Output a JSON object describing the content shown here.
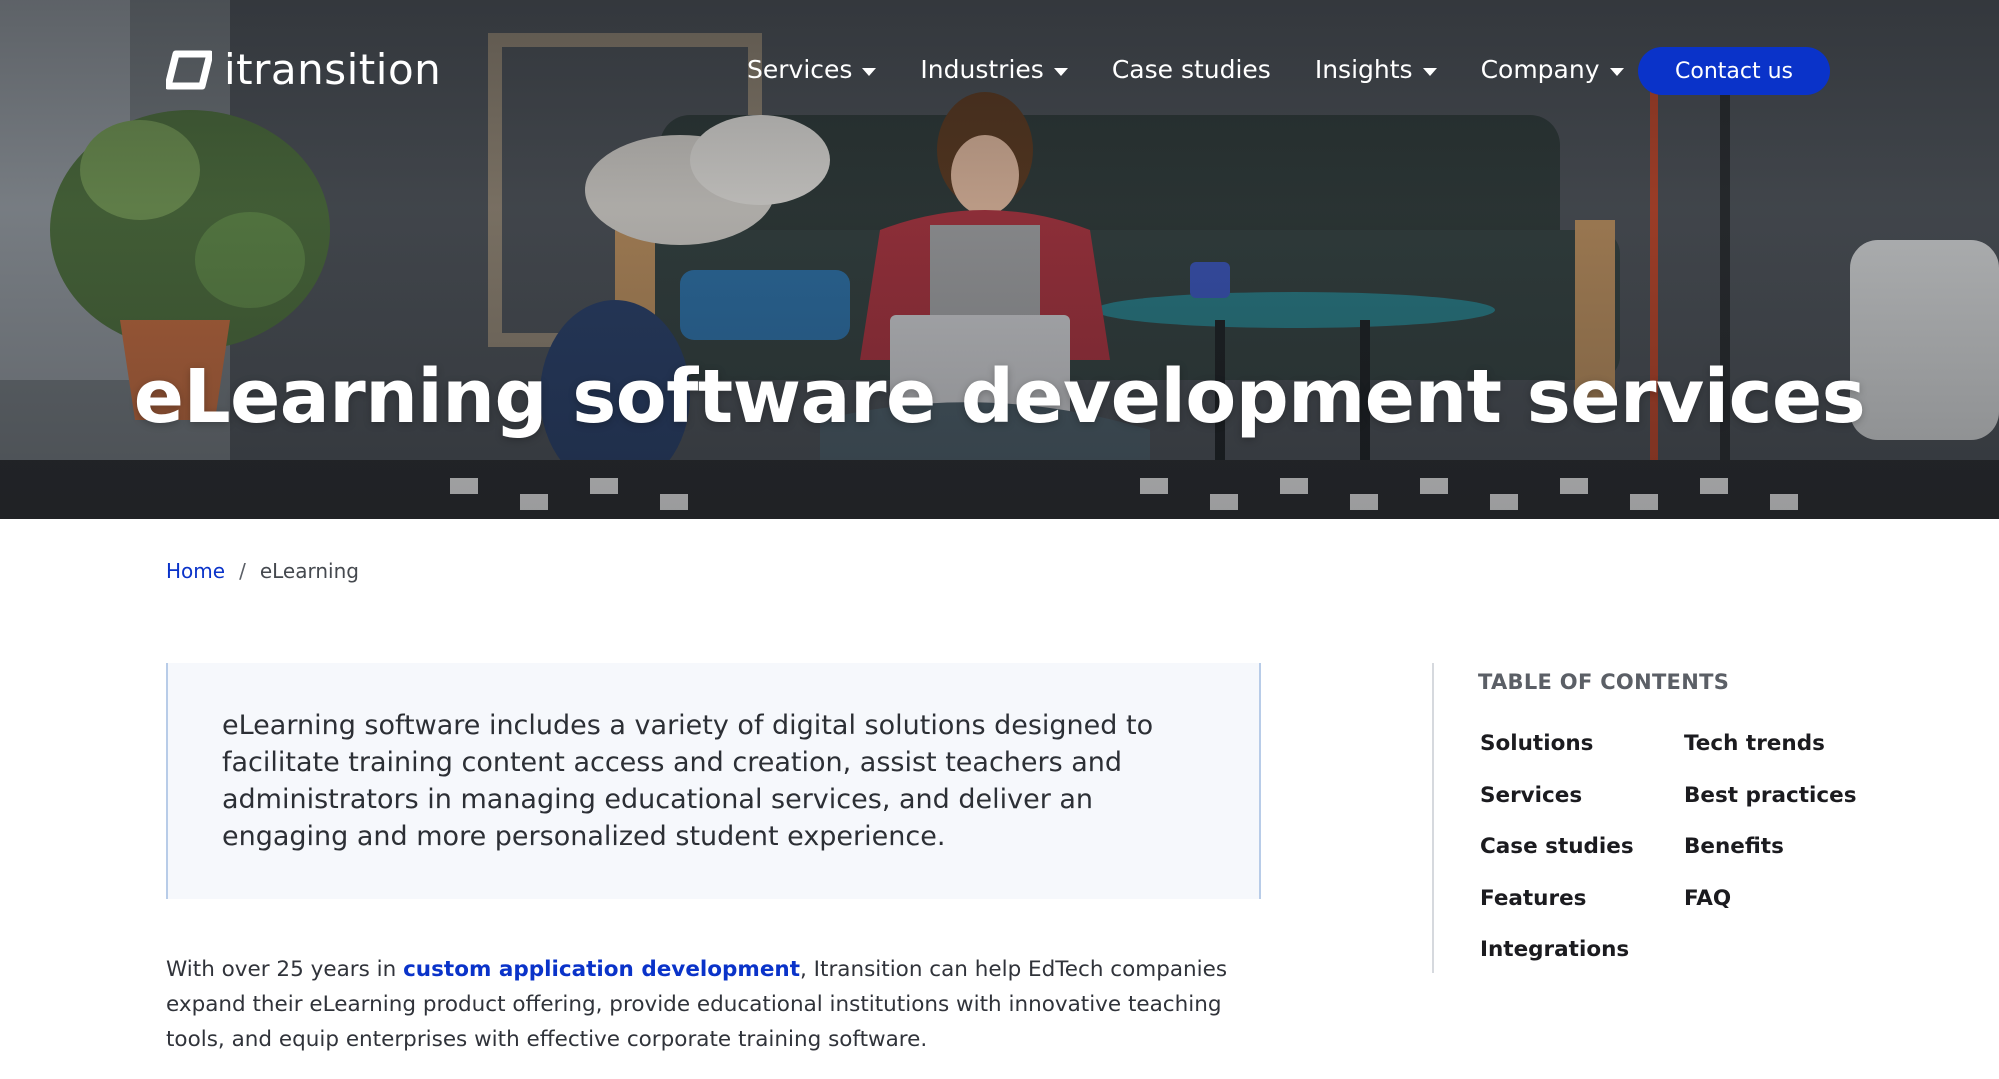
{
  "header": {
    "logo_text": "itransition",
    "nav": [
      {
        "label": "Services",
        "dropdown": true
      },
      {
        "label": "Industries",
        "dropdown": true
      },
      {
        "label": "Case studies",
        "dropdown": false
      },
      {
        "label": "Insights",
        "dropdown": true
      },
      {
        "label": "Company",
        "dropdown": true
      }
    ],
    "contact_label": "Contact us"
  },
  "hero": {
    "title": "eLearning software development services"
  },
  "breadcrumb": {
    "home": "Home",
    "separator": "/",
    "current": "eLearning"
  },
  "intro": {
    "text": "eLearning software includes a variety of digital solutions designed to facilitate training content access and creation, assist teachers and administrators in managing educational services, and deliver an engaging and more personalized student experience."
  },
  "body": {
    "before_link": "With over 25 years in ",
    "link_text": "custom application development",
    "after_link": ", Itransition can help EdTech companies expand their eLearning product offering, provide educational institutions with innovative teaching tools, and equip enterprises with effective corporate training software."
  },
  "toc": {
    "title": "TABLE OF CONTENTS",
    "items": [
      "Solutions",
      "Tech trends",
      "Services",
      "Best practices",
      "Case studies",
      "Benefits",
      "Features",
      "FAQ",
      "Integrations"
    ]
  },
  "colors": {
    "brand_blue": "#0a33c9",
    "intro_bg": "#f6f8fc",
    "intro_border": "#b8cce8"
  }
}
